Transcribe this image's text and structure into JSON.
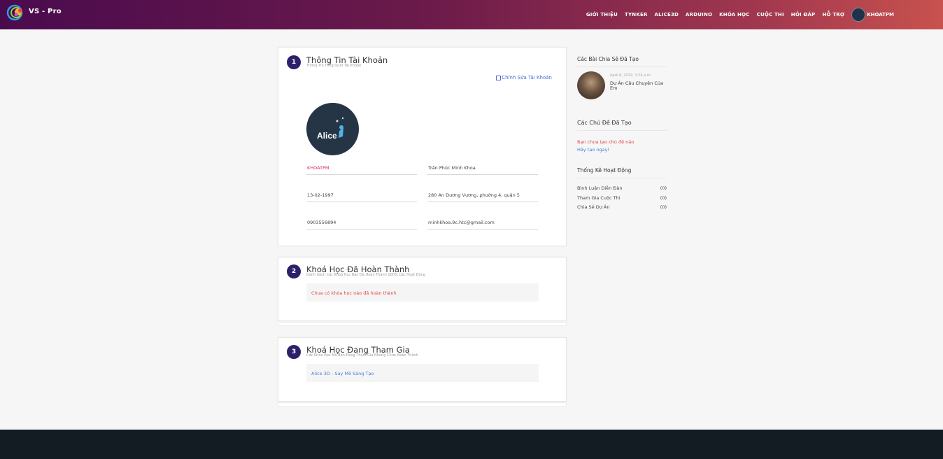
{
  "header": {
    "logo_text": "VS - Pro",
    "nav": [
      "GIỚI THIỆU",
      "TYNKER",
      "ALICE3D",
      "ARDUINO",
      "KHÓA HỌC",
      "CUỘC THI",
      "HỎI ĐÁP",
      "HỖ TRỢ"
    ],
    "user_label": "KHOATPM"
  },
  "account": {
    "step": "1",
    "title": "Thông Tin Tài Khoản",
    "subtitle": "Thông Tin Tổng Quát Tài Khoản",
    "edit_label": "Chỉnh Sửa Tài Khoản",
    "avatar_text": "Alice",
    "username": "KHOATPM",
    "fullname": "Trần Phúc Minh Khoa",
    "birthday": "13-02-1997",
    "address": "280 An Dương Vương, phường 4, quận 5",
    "phone": "0903556894",
    "email": "minhkhoa.9c.htc@gmail.com"
  },
  "completed": {
    "step": "2",
    "title": "Khoá Học Đã Hoàn Thành",
    "subtitle": "Danh Sách Các Khoá Học Bạn Đã Hoàn Thành 100% Các Hoạt Động",
    "empty": "Chưa có khóa học nào đã hoàn thành"
  },
  "ongoing": {
    "step": "3",
    "title": "Khoá Học Đang Tham Gia",
    "subtitle": "Các Khóa Học Mà Bạn Đang Tham Gia Nhưng Chưa Hoàn Thành",
    "course": "Alice 3D - Say Mê Sáng Tạo"
  },
  "sidebar": {
    "shared_title": "Các Bài Chia Sẻ Đã Tạo",
    "post_date": "April 8, 2019, 3:24 p.m.",
    "post_title": "Dự Án Câu Chuyện Của Em",
    "topics_title": "Các Chủ Đề Đã Tạo",
    "topics_empty": "Bạn chưa tạo chủ đề nào",
    "topics_create": "Hãy tạo ngay!",
    "stats_title": "Thống Kê Hoạt Động",
    "stats": [
      {
        "label": "Bình Luận Diễn Đàn",
        "value": "(0)"
      },
      {
        "label": "Tham Gia Cuộc Thi",
        "value": "(0)"
      },
      {
        "label": "Chia Sẻ Dự Án",
        "value": "(0)"
      }
    ]
  },
  "colors": {
    "header_start": "#4a0b4e",
    "header_end": "#c8524e",
    "step_badge": "#2e1f6b",
    "username_pink": "#d7286b",
    "link_blue": "#4a6ed4",
    "empty_red": "#e04545",
    "footer": "#131b23"
  },
  "icons": {
    "logo": "colorful-swirl-logo",
    "edit": "edit-square-icon"
  }
}
